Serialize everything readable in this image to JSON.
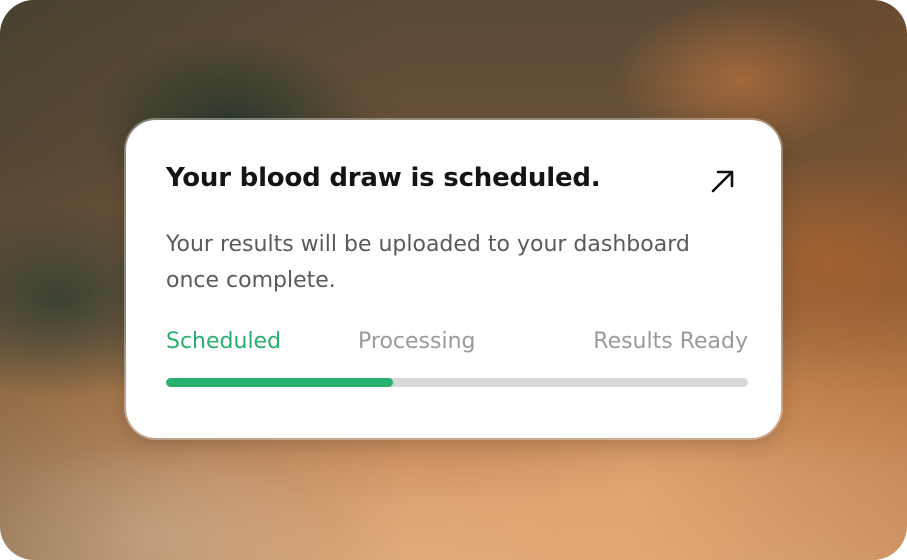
{
  "card": {
    "title": "Your blood draw is scheduled.",
    "body": "Your results will be uploaded to your dashboard once complete.",
    "open_icon": "arrow-up-right-icon"
  },
  "progress": {
    "steps": [
      "Scheduled",
      "Processing",
      "Results Ready"
    ],
    "current_step": "Scheduled",
    "fill_fraction": 0.39
  },
  "colors": {
    "accent": "#27b06e",
    "inactive_step": "#9a9a9a",
    "track": "#d8d8d8",
    "title": "#141414",
    "body_text": "#5a5a5a"
  }
}
